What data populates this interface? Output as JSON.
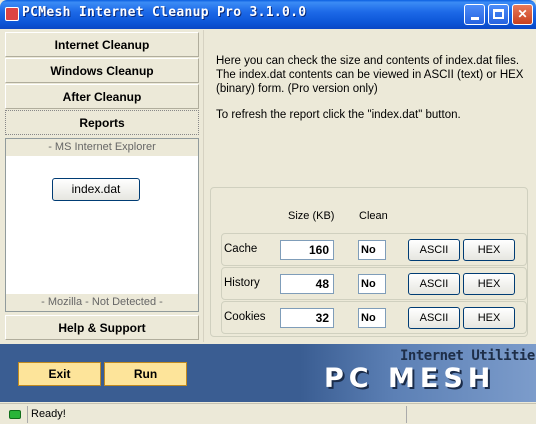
{
  "window": {
    "title": "PCMesh Internet Cleanup Pro 3.1.0.0",
    "min_icon": "minimize-icon",
    "max_icon": "maximize-icon",
    "close_glyph": "✕"
  },
  "nav": {
    "items": [
      {
        "label": "Internet Cleanup"
      },
      {
        "label": "Windows Cleanup"
      },
      {
        "label": "After Cleanup"
      },
      {
        "label": "Reports"
      }
    ],
    "browser_head": "- MS Internet Explorer",
    "index_button": "index.dat",
    "browser_foot": "- Mozilla - Not Detected -",
    "help": "Help & Support"
  },
  "info": {
    "line1": "Here you can check the size and contents of index.dat files. The index.dat contents can be viewed in ASCII (text) or HEX (binary) form. (Pro version only)",
    "line2": "To refresh the report click the \"index.dat\" button."
  },
  "report": {
    "col_size": "Size (KB)",
    "col_clean": "Clean",
    "rows": [
      {
        "label": "Cache",
        "size": "160",
        "clean": "No",
        "ascii": "ASCII",
        "hex": "HEX"
      },
      {
        "label": "History",
        "size": "48",
        "clean": "No",
        "ascii": "ASCII",
        "hex": "HEX"
      },
      {
        "label": "Cookies",
        "size": "32",
        "clean": "No",
        "ascii": "ASCII",
        "hex": "HEX"
      }
    ]
  },
  "actions": {
    "exit": "Exit",
    "run": "Run"
  },
  "branding": {
    "tagline": "Internet Utilities",
    "name": "PC MESH"
  },
  "status": {
    "text": "Ready!"
  },
  "colors": {
    "titlebar": "#0b54d6",
    "band": "#3a5d92",
    "action_button": "#fde49a",
    "status_ok": "#29b439"
  }
}
